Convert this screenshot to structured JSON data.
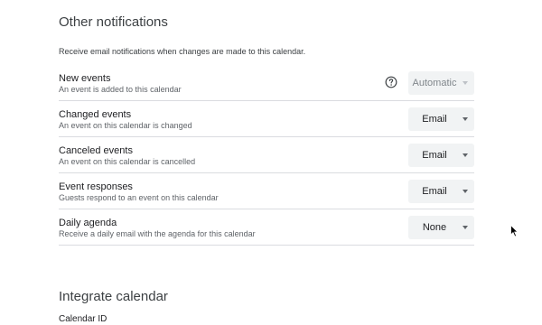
{
  "other_notifications": {
    "title": "Other notifications",
    "description": "Receive email notifications when changes are made to this calendar.",
    "rows": [
      {
        "title": "New events",
        "subtitle": "An event is added to this calendar",
        "value": "Automatic",
        "disabled": true,
        "has_help": true
      },
      {
        "title": "Changed events",
        "subtitle": "An event on this calendar is changed",
        "value": "Email"
      },
      {
        "title": "Canceled events",
        "subtitle": "An event on this calendar is cancelled",
        "value": "Email"
      },
      {
        "title": "Event responses",
        "subtitle": "Guests respond to an event on this calendar",
        "value": "Email"
      },
      {
        "title": "Daily agenda",
        "subtitle": "Receive a daily email with the agenda for this calendar",
        "value": "None"
      }
    ]
  },
  "integrate_calendar": {
    "title": "Integrate calendar",
    "calendar_id_label": "Calendar ID"
  },
  "icons": {
    "help": "help-circle-icon",
    "dropdown": "caret-down-icon",
    "cursor": "mouse-pointer-icon"
  }
}
